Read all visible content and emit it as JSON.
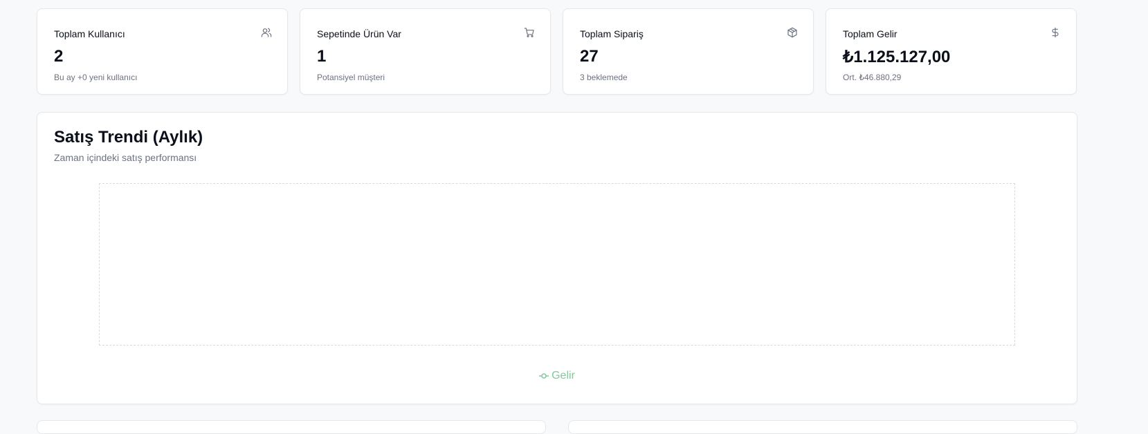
{
  "stats": [
    {
      "title": "Toplam Kullanıcı",
      "value": "2",
      "sub": "Bu ay +0 yeni kullanıcı",
      "icon": "users-icon"
    },
    {
      "title": "Sepetinde Ürün Var",
      "value": "1",
      "sub": "Potansiyel müşteri",
      "icon": "shopping-cart-icon"
    },
    {
      "title": "Toplam Sipariş",
      "value": "27",
      "sub": "3 beklemede",
      "icon": "package-icon"
    },
    {
      "title": "Toplam Gelir",
      "value": "₺1.125.127,00",
      "sub": "Ort. ₺46.880,29",
      "icon": "dollar-sign-icon"
    }
  ],
  "sales_chart": {
    "title": "Satış Trendi (Aylık)",
    "subtitle": "Zaman içindeki satış performansı",
    "legend_label": "Gelir",
    "legend_color": "#7fc99a"
  },
  "chart_data": {
    "type": "line",
    "title": "Satış Trendi (Aylık)",
    "subtitle": "Zaman içindeki satış performansı",
    "series": [
      {
        "name": "Gelir",
        "values": []
      }
    ],
    "categories": [],
    "grid": false,
    "legend": "bottom-center"
  }
}
